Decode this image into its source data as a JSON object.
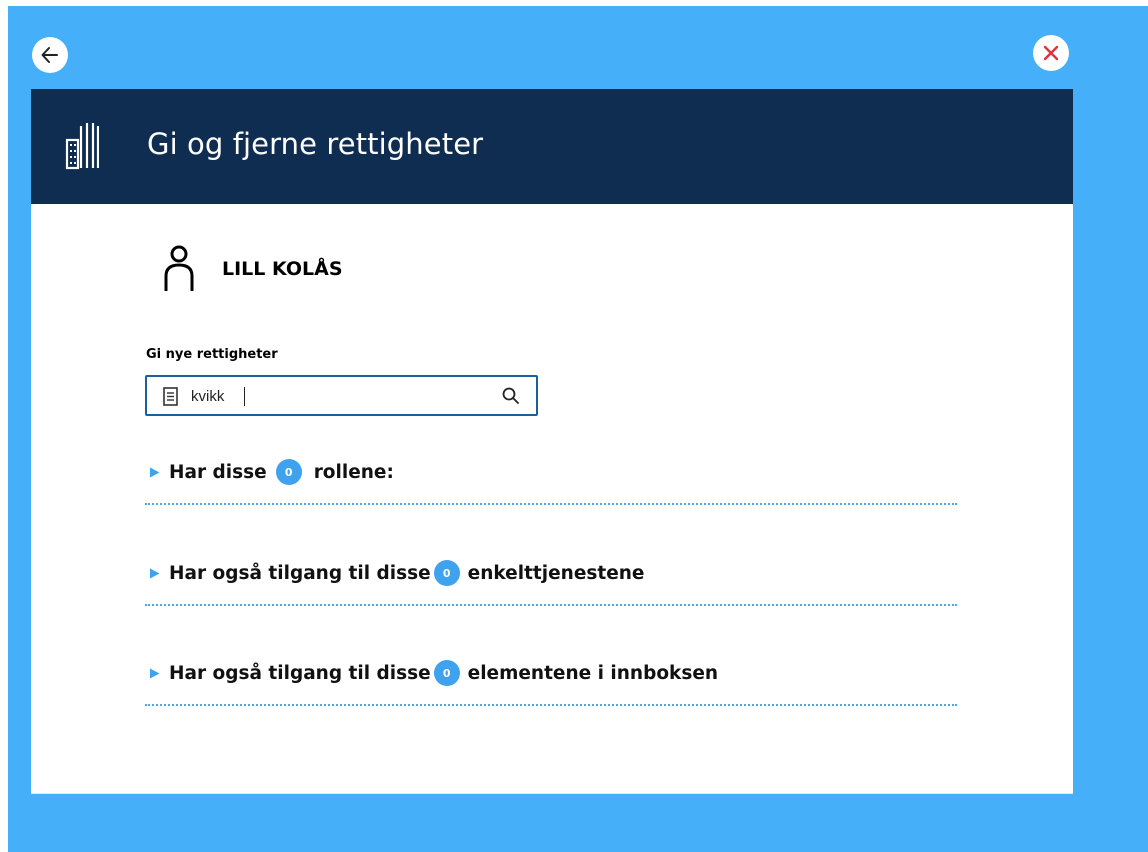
{
  "colors": {
    "background": "#45aff9",
    "header": "#0e2d50",
    "accent": "#3fa2ef",
    "input_border": "#1b5f9f",
    "close_icon": "#e0313f"
  },
  "nav": {
    "back_icon": "arrow-left-icon",
    "close_icon": "close-x-icon"
  },
  "header": {
    "icon": "building-icon",
    "title": "Gi og fjerne rettigheter"
  },
  "user": {
    "icon": "person-icon",
    "name": "LILL KOLÅS"
  },
  "search": {
    "label": "Gi nye rettigheter",
    "value": "kvikk",
    "leading_icon": "document-icon",
    "trailing_icon": "search-icon"
  },
  "sections": [
    {
      "pre": "Har disse",
      "count": "0",
      "post": "rollene:"
    },
    {
      "pre": "Har også tilgang til disse",
      "count": "0",
      "post": "enkelttjenestene"
    },
    {
      "pre": "Har også tilgang til disse",
      "count": "0",
      "post": "elementene i innboksen"
    }
  ]
}
